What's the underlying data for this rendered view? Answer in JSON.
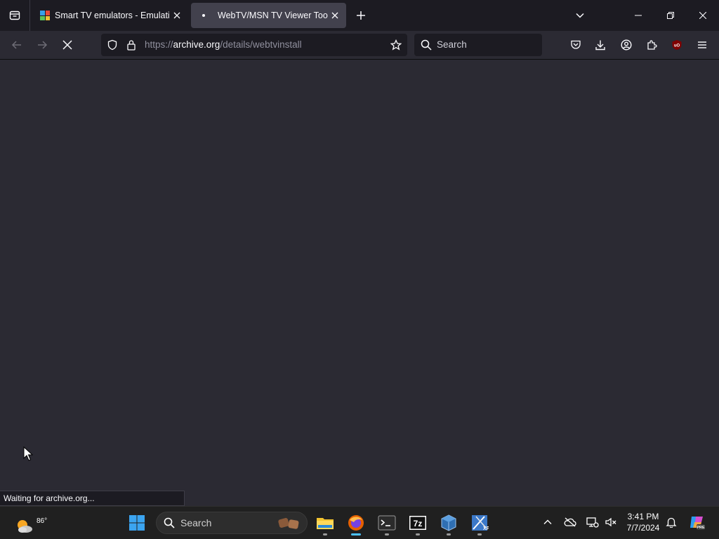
{
  "tabs": [
    {
      "title": "Smart TV emulators - Emulation General Wiki",
      "active": false
    },
    {
      "title": "WebTV/MSN TV Viewer Tool : WebTV Networks",
      "active": true
    }
  ],
  "navbar": {
    "url_scheme": "https://",
    "url_host": "archive.org",
    "url_path": "/details/webtvinstall",
    "search_placeholder": "Search"
  },
  "status_text": "Waiting for archive.org...",
  "taskbar": {
    "weather_temp": "86°",
    "search_placeholder": "Search",
    "time": "3:41 PM",
    "date": "7/7/2024",
    "apps": [
      "file-explorer",
      "firefox",
      "terminal",
      "7-zip",
      "virtualbox",
      "windows-xp-vm"
    ]
  },
  "colors": {
    "window_bg": "#1c1b22",
    "toolbar_bg": "#2b2a33",
    "active_tab": "#42414d",
    "taskbar_bg": "#202020",
    "accent": "#4cc2ff"
  }
}
